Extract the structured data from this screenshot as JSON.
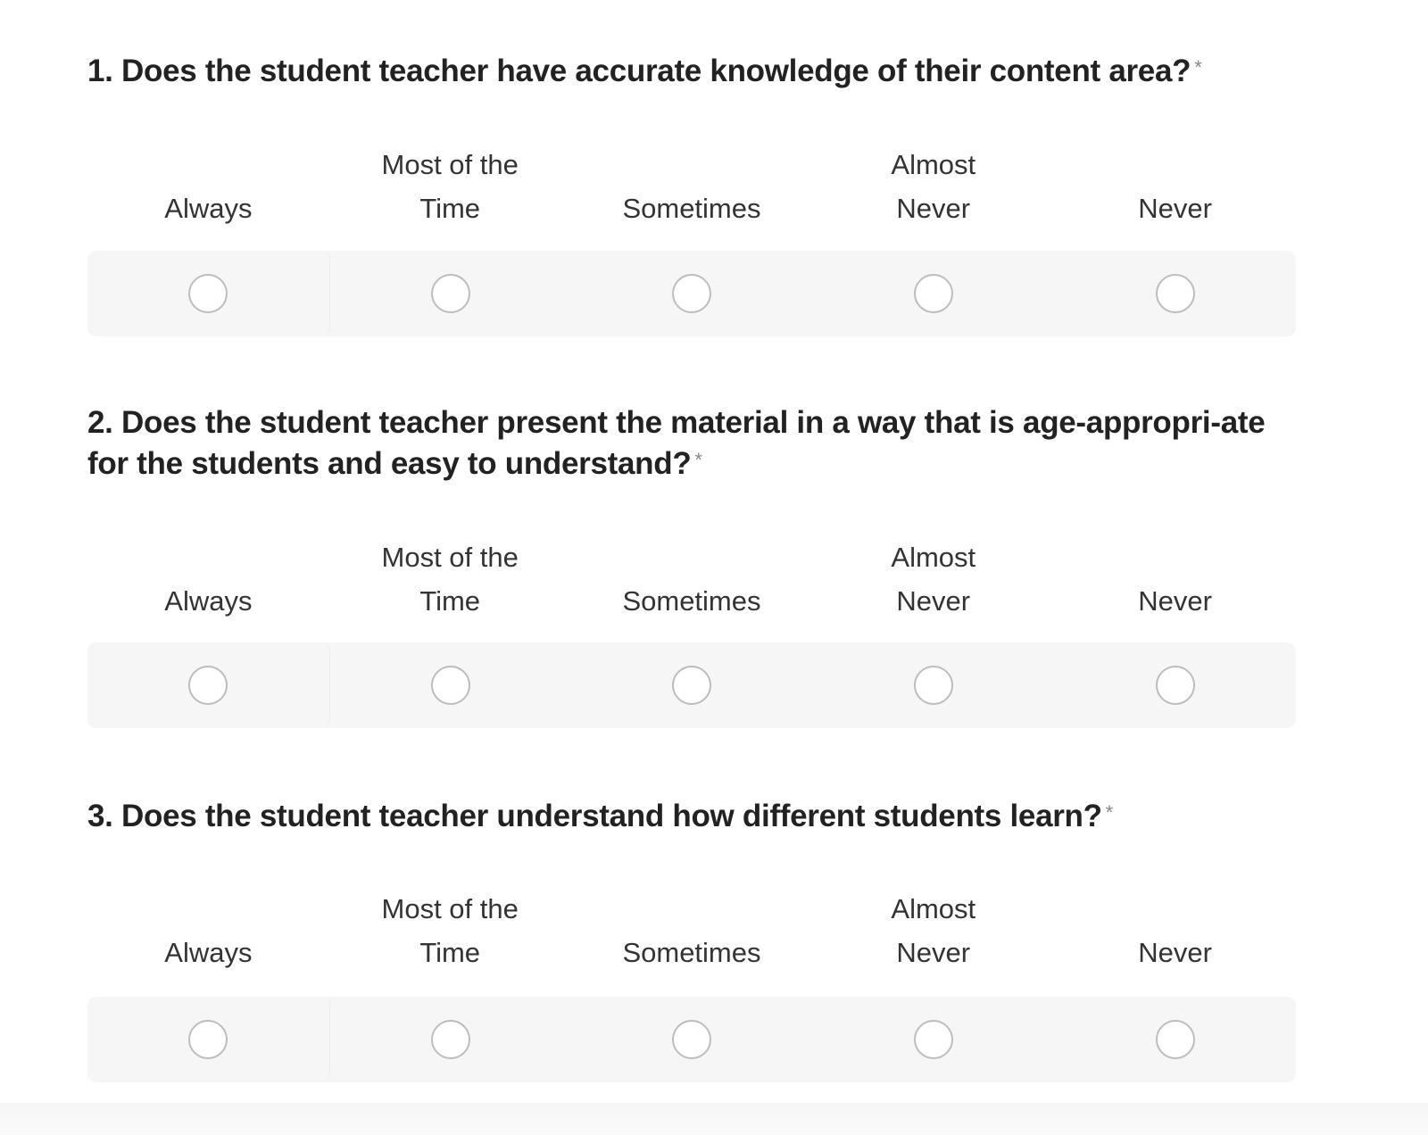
{
  "scale_options": [
    {
      "label": "Always"
    },
    {
      "label": "Most of the Time"
    },
    {
      "label": "Sometimes"
    },
    {
      "label": "Almost Never"
    },
    {
      "label": "Never"
    }
  ],
  "questions": [
    {
      "title": "1. Does the student teacher have accurate knowledge of their content area?",
      "required_marker": "*",
      "options": [
        "Always",
        "Most of the Time",
        "Sometimes",
        "Almost Never",
        "Never"
      ],
      "selected": null
    },
    {
      "title": "2. Does the student teacher present the material in a way that is age-appropri-ate for the students and easy to understand?",
      "required_marker": "*",
      "options": [
        "Always",
        "Most of the Time",
        "Sometimes",
        "Almost Never",
        "Never"
      ],
      "selected": null
    },
    {
      "title": "3. Does the student teacher understand how different students learn?",
      "required_marker": "*",
      "options": [
        "Always",
        "Most of the Time",
        "Sometimes",
        "Almost Never",
        "Never"
      ],
      "selected": null
    }
  ],
  "colors": {
    "title_text": "#222222",
    "label_text": "#333333",
    "required_marker": "#888888",
    "row_background": "#f6f6f6",
    "radio_border": "#bdbdbd",
    "radio_fill": "#ffffff"
  }
}
